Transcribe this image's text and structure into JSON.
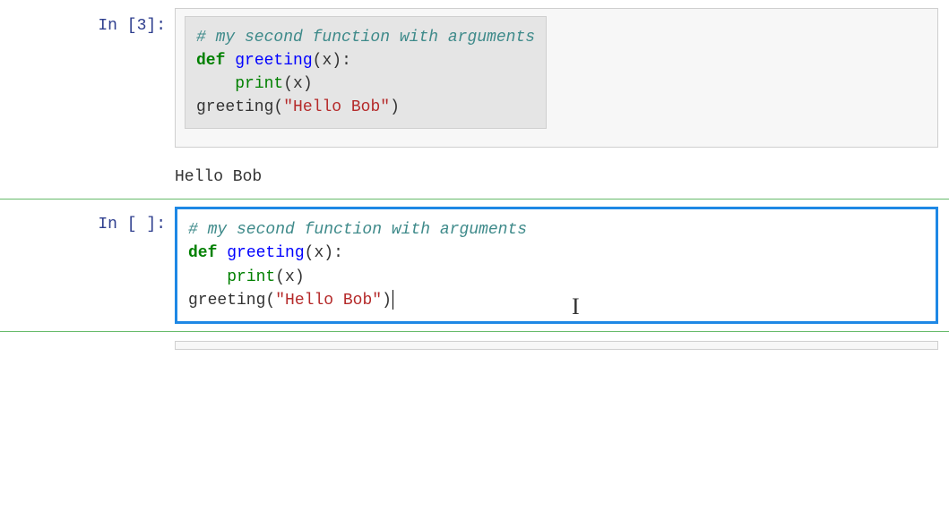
{
  "cell1": {
    "prompt_prefix": "In [",
    "prompt_num": "3",
    "prompt_suffix": "]:",
    "line1": {
      "comment": "# my second function with arguments"
    },
    "line2": {
      "kw": "def",
      "sp": " ",
      "fn": "greeting",
      "open": "(",
      "arg": "x",
      "close": ")",
      "colon": ":"
    },
    "line3": {
      "indent": "    ",
      "builtin": "print",
      "open": "(",
      "arg": "x",
      "close": ")"
    },
    "line4": {
      "fn": "greeting",
      "open": "(",
      "str": "\"Hello Bob\"",
      "close": ")"
    },
    "output": "Hello Bob"
  },
  "cell2": {
    "prompt_prefix": "In [",
    "prompt_num": " ",
    "prompt_suffix": "]:",
    "line1": {
      "comment": "# my second function with arguments"
    },
    "line2": {
      "kw": "def",
      "sp": " ",
      "fn": "greeting",
      "open": "(",
      "arg": "x",
      "close": ")",
      "colon": ":"
    },
    "line3": {
      "indent": "    ",
      "builtin": "print",
      "open": "(",
      "arg": "x",
      "close": ")"
    },
    "line4": {
      "fn": "greeting",
      "open": "(",
      "str": "\"Hello Bob\"",
      "close": ")"
    }
  },
  "colors": {
    "selection_bg": "#e5e5e5",
    "active_border": "#1e88e5",
    "divider": "#66BB6A",
    "comment": "#3e8a8a",
    "keyword": "#008000",
    "string": "#b52a2a"
  }
}
